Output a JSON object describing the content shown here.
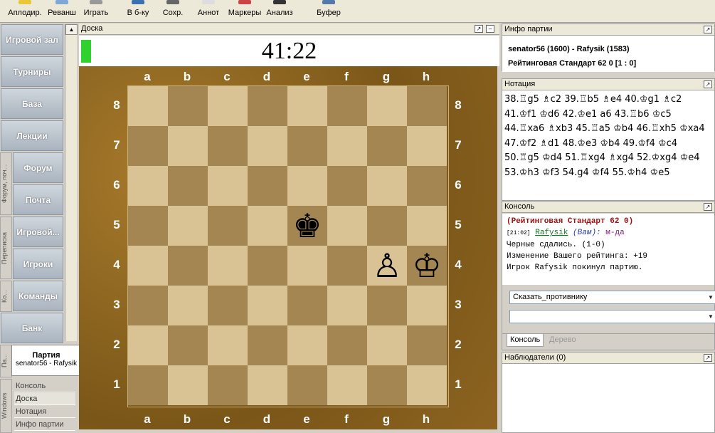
{
  "toolbar": {
    "items": [
      {
        "label": "Аплодир.",
        "icon": "applause-icon"
      },
      {
        "label": "Реванш",
        "icon": "rematch-icon"
      },
      {
        "label": "Играть",
        "icon": "play-icon"
      },
      {
        "label": "В б-ку",
        "icon": "library-icon"
      },
      {
        "label": "Сохр.",
        "icon": "save-icon"
      },
      {
        "label": "Аннот",
        "icon": "annotate-icon"
      },
      {
        "label": "Маркеры",
        "icon": "markers-icon"
      },
      {
        "label": "Анализ",
        "icon": "analysis-icon"
      },
      {
        "label": "Буфер",
        "icon": "clipboard-icon"
      }
    ]
  },
  "nav": {
    "items": [
      "Игровой зал",
      "Турниры",
      "База",
      "Лекции",
      "Форум",
      "Почта",
      "Игровой...",
      "Игроки",
      "Команды",
      "Банк"
    ],
    "side_tabs": [
      "Форум, поч...",
      "Переписка",
      "Ко...",
      "Па...",
      "Windows"
    ]
  },
  "party_popup": {
    "title": "Партия",
    "players": "senator56 - Rafysik"
  },
  "window_list": [
    "Консоль",
    "Доска",
    "Нотация",
    "Инфо партии"
  ],
  "board_panel": {
    "title": "Доска",
    "clock": "41:22",
    "files": [
      "a",
      "b",
      "c",
      "d",
      "e",
      "f",
      "g",
      "h"
    ],
    "ranks": [
      "8",
      "7",
      "6",
      "5",
      "4",
      "3",
      "2",
      "1"
    ],
    "pieces": [
      {
        "square": "e5",
        "glyph": "♚",
        "name": "black-king"
      },
      {
        "square": "g4",
        "glyph": "♙",
        "name": "white-pawn"
      },
      {
        "square": "h4",
        "glyph": "♔",
        "name": "white-king"
      }
    ],
    "accent_color": "#2ed12e"
  },
  "game_info": {
    "title": "Инфо партии",
    "players": "senator56 (1600) - Rafysik (1583)",
    "details": "Рейтинговая Стандарт 62 0 [1 : 0]"
  },
  "notation": {
    "title": "Нотация",
    "text": "38.♖g5 ♗c2 39.♖b5 ♗e4 40.♔g1 ♗c2 41.♔f1 ♔d6 42.♔e1 a6 43.♖b6 ♔c5 44.♖xa6 ♗xb3 45.♖a5 ♔b4 46.♖xh5 ♔xa4 47.♔f2 ♗d1 48.♔e3 ♔b4 49.♔f4 ♔c4 50.♖g5 ♔d4 51.♖xg4 ♗xg4 52.♔xg4 ♔e4 53.♔h3 ♔f3 54.g4 ♔f4 55.♔h4 ♔e5"
  },
  "console": {
    "title": "Консоль",
    "header": "(Рейтинговая Стандарт 62 0)",
    "time": "[21:02]",
    "user": "Rafysik",
    "you": "(Вам):",
    "message": "м-да",
    "lines": [
      "Черные сдались. (1-0)",
      "Изменение Вашего рейтинга: +19",
      "Игрок Rafysik покинул партию."
    ],
    "say_select": "Сказать_противнику",
    "tabs": [
      "Консоль",
      "Дерево"
    ]
  },
  "observers": {
    "title": "Наблюдатели (0)"
  }
}
